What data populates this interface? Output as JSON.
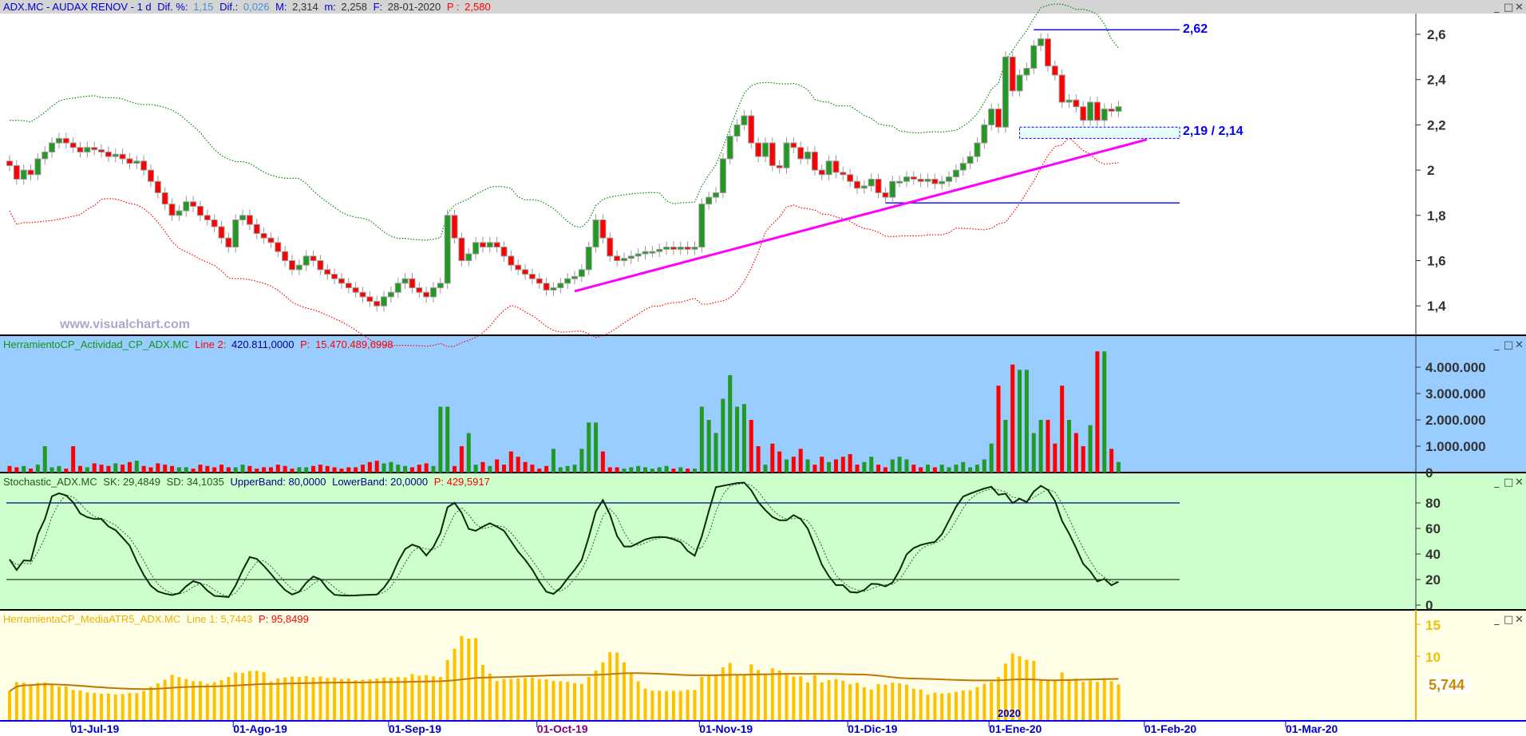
{
  "price_header": {
    "symbol": "ADX.MC - AUDAX RENOV -  1 d",
    "dif_pct_label": "Dif. %:",
    "dif_pct": "1,15",
    "dif_label": "Dif.:",
    "dif": "0,026",
    "max_label": "M:",
    "max": "2,314",
    "min_label": "m:",
    "min": "2,258",
    "date_label": "F:",
    "date": "28-01-2020",
    "p_label": "P :",
    "p": "2,580"
  },
  "watermark": "www.visualchart.com",
  "annotations": {
    "resistance_label": "2,62",
    "resistance": 2.62,
    "zone_label": "2,19 / 2,14",
    "zone_top": 2.19,
    "zone_bottom": 2.14,
    "support": 1.855,
    "trendline": {
      "from_index": 80,
      "from_price": 1.465,
      "to_index": 161,
      "to_price": 2.135
    }
  },
  "volume_header": {
    "name": "HerramientoCP_Actividad_CP_ADX.MC",
    "line_label": "Line 2:",
    "line_value": "420.811,0000",
    "p_label": "P:",
    "p_value": "15.470.489,6998"
  },
  "stoch_header": {
    "name": "Stochastic_ADX.MC",
    "sk": "SK: 29,4849",
    "sd": "SD: 34,1035",
    "upper": "UpperBand: 80,0000",
    "lower": "LowerBand: 20,0000",
    "p": "P: 429,5917"
  },
  "atr_header": {
    "name": "HerramientaCP_MediaATR5_ADX.MC",
    "line": "Line 1: 5,7443",
    "p": "P: 95,8499"
  },
  "atr_last_label": "5,744",
  "year_label": "2020",
  "window_buttons": {
    "minimize": "_",
    "maximize": "□",
    "close": "✕"
  },
  "colors": {
    "up": "#229922",
    "down": "#ff0000",
    "special": "#0000ff",
    "trend": "#ff00ff",
    "vol_bg": "#99ccff",
    "stoch_bg": "#ccffcc",
    "atr_bg": "#ffffe8"
  },
  "chart_data": {
    "type": "candlestick",
    "price": {
      "y_ticks": [
        "2,6",
        "2,4",
        "2,2",
        "2",
        "1,8",
        "1,6",
        "1,4"
      ],
      "y_tick_values": [
        2.6,
        2.4,
        2.2,
        2.0,
        1.8,
        1.6,
        1.4
      ],
      "closes": [
        2.02,
        1.96,
        2.0,
        1.98,
        2.05,
        2.08,
        2.12,
        2.14,
        2.12,
        2.1,
        2.08,
        2.1,
        2.09,
        2.08,
        2.06,
        2.07,
        2.05,
        2.03,
        2.04,
        2.0,
        1.95,
        1.9,
        1.85,
        1.8,
        1.82,
        1.86,
        1.84,
        1.8,
        1.78,
        1.75,
        1.7,
        1.66,
        1.78,
        1.8,
        1.76,
        1.72,
        1.7,
        1.68,
        1.64,
        1.6,
        1.56,
        1.58,
        1.62,
        1.6,
        1.56,
        1.54,
        1.52,
        1.5,
        1.48,
        1.46,
        1.44,
        1.42,
        1.4,
        1.44,
        1.46,
        1.5,
        1.52,
        1.48,
        1.46,
        1.44,
        1.48,
        1.5,
        1.8,
        1.7,
        1.6,
        1.63,
        1.68,
        1.66,
        1.68,
        1.66,
        1.62,
        1.58,
        1.56,
        1.54,
        1.52,
        1.5,
        1.47,
        1.48,
        1.5,
        1.52,
        1.53,
        1.56,
        1.66,
        1.78,
        1.7,
        1.62,
        1.6,
        1.61,
        1.62,
        1.63,
        1.64,
        1.64,
        1.65,
        1.66,
        1.65,
        1.66,
        1.65,
        1.66,
        1.85,
        1.88,
        1.9,
        2.05,
        2.15,
        2.2,
        2.24,
        2.12,
        2.06,
        2.12,
        2.02,
        2.01,
        2.12,
        2.1,
        2.05,
        2.08,
        2.0,
        1.98,
        2.04,
        1.99,
        1.98,
        1.95,
        1.92,
        1.93,
        1.96,
        1.9,
        1.88,
        1.95,
        1.95,
        1.97,
        1.96,
        1.95,
        1.96,
        1.94,
        1.95,
        1.97,
        2.0,
        2.03,
        2.06,
        2.12,
        2.2,
        2.27,
        2.19,
        2.5,
        2.35,
        2.42,
        2.45,
        2.55,
        2.58,
        2.46,
        2.42,
        2.3,
        2.31,
        2.28,
        2.22,
        2.3,
        2.22,
        2.27,
        2.26,
        2.28
      ]
    },
    "volume": {
      "y_ticks": [
        "4.000.000",
        "3.000.000",
        "2.000.000",
        "1.000.000",
        "0"
      ],
      "y_tick_values": [
        4000000,
        3000000,
        2000000,
        1000000,
        0
      ],
      "values_thousands": [
        250,
        200,
        250,
        150,
        300,
        1000,
        200,
        250,
        150,
        1000,
        250,
        200,
        350,
        300,
        250,
        350,
        300,
        400,
        450,
        250,
        200,
        350,
        300,
        250,
        200,
        200,
        150,
        300,
        250,
        200,
        300,
        200,
        200,
        300,
        250,
        150,
        200,
        200,
        300,
        250,
        150,
        200,
        200,
        250,
        300,
        250,
        200,
        150,
        200,
        200,
        300,
        400,
        450,
        350,
        400,
        300,
        250,
        200,
        300,
        350,
        250,
        2500,
        2500,
        250,
        1000,
        1500,
        300,
        400,
        250,
        500,
        300,
        800,
        600,
        400,
        300,
        150,
        250,
        900,
        200,
        250,
        300,
        900,
        1900,
        1900,
        800,
        200,
        200,
        150,
        200,
        250,
        200,
        150,
        200,
        250,
        150,
        200,
        150,
        150,
        2500,
        2000,
        1500,
        2800,
        3700,
        2500,
        2600,
        2000,
        1000,
        300,
        1100,
        800,
        500,
        600,
        900,
        500,
        300,
        600,
        400,
        500,
        600,
        700,
        300,
        400,
        600,
        300,
        200,
        500,
        600,
        500,
        300,
        200,
        300,
        200,
        300,
        200,
        300,
        400,
        200,
        300,
        500,
        1100,
        3300,
        2000,
        4100,
        3900,
        3900,
        1500,
        2000,
        2000,
        1100,
        3300,
        2000,
        1500,
        1000,
        1800,
        4600,
        4600,
        900,
        400
      ]
    },
    "stochastic": {
      "y_ticks": [
        "80",
        "60",
        "40",
        "20",
        "0"
      ],
      "y_tick_values": [
        80,
        60,
        40,
        20,
        0
      ],
      "upper_band": 80,
      "lower_band": 20,
      "sk_last": 29.4849,
      "sd_last": 34.1035
    },
    "atr": {
      "y_ticks": [
        "15",
        "10"
      ],
      "y_tick_values": [
        15,
        10
      ],
      "last": 5.7443
    },
    "x_ticks": [
      {
        "label": "01-Jul-19",
        "index": 9
      },
      {
        "label": "01-Ago-19",
        "index": 32
      },
      {
        "label": "01-Sep-19",
        "index": 54
      },
      {
        "label": "01-Oct-19",
        "index": 75
      },
      {
        "label": "01-Nov-19",
        "index": 98
      },
      {
        "label": "01-Dic-19",
        "index": 119
      },
      {
        "label": "01-Ene-20",
        "index": 139
      },
      {
        "label": "01-Feb-20",
        "index": 161
      },
      {
        "label": "01-Mar-20",
        "index": 181
      }
    ]
  }
}
